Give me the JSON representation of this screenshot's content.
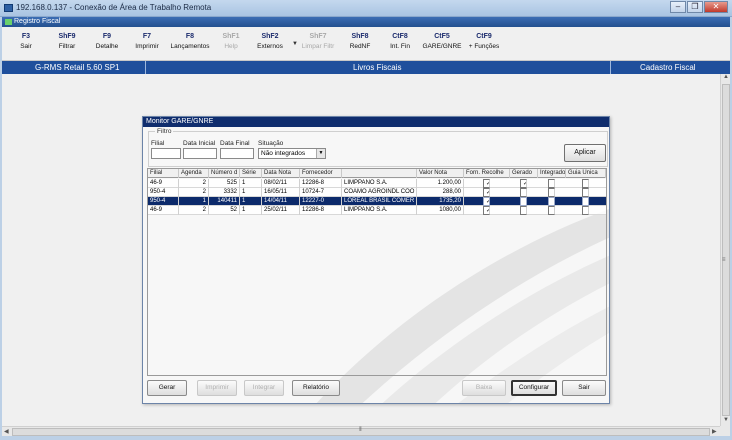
{
  "window": {
    "title": "192.168.0.137 - Conexão de Área de Trabalho Remota"
  },
  "app": {
    "title": "Registro Fiscal"
  },
  "toolbar": {
    "buttons": [
      {
        "key": "F3",
        "label": "Sair",
        "enabled": true
      },
      {
        "key": "ShF9",
        "label": "Filtrar",
        "enabled": true
      },
      {
        "key": "F9",
        "label": "Detalhe",
        "enabled": true
      },
      {
        "key": "F7",
        "label": "Imprimir",
        "enabled": true
      },
      {
        "key": "F8",
        "label": "Lançamentos",
        "enabled": true
      },
      {
        "key": "ShF1",
        "label": "Help",
        "enabled": false
      },
      {
        "key": "ShF2",
        "label": "Externos",
        "enabled": true
      },
      {
        "key": "ShF7",
        "label": "Limpar Filtr",
        "enabled": false
      },
      {
        "key": "ShF8",
        "label": "RedNF",
        "enabled": true
      },
      {
        "key": "CtF8",
        "label": "Int. Fin",
        "enabled": true
      },
      {
        "key": "CtF5",
        "label": "GARE/GNRE",
        "enabled": true
      },
      {
        "key": "CtF9",
        "label": "+ Funções",
        "enabled": true
      }
    ]
  },
  "infobar": {
    "product": "G-RMS Retail 5.60 SP1",
    "module": "Livros Fiscais",
    "screen": "Cadastro Fiscal"
  },
  "dialog": {
    "title": "Monitor GARE/GNRE",
    "filter": {
      "legend": "Filtro",
      "filial_label": "Filial",
      "data_inicial_label": "Data Inicial",
      "data_final_label": "Data Final",
      "situacao_label": "Situação",
      "filial_value": "",
      "data_inicial_value": "",
      "data_final_value": "",
      "situacao_value": "Não integrados",
      "apply_label": "Aplicar"
    },
    "table": {
      "headers": [
        "Filial",
        "Agenda",
        "Número d",
        "Série",
        "Data Nota",
        "Fornecedor",
        "",
        "Valor Nota",
        "Forn. Recolhe",
        "Gerado",
        "Integrado",
        "Guia Única"
      ],
      "rows": [
        {
          "filial": "46-9",
          "agenda": "2",
          "numero": "525",
          "serie": "1",
          "data": "08/02/11",
          "forn_cod": "12286-8",
          "forn_nome": "LIMPPANO S.A.",
          "valor": "1.200,00",
          "recolhe": true,
          "gerado": true,
          "integrado": false,
          "guia": false,
          "selected": false
        },
        {
          "filial": "950-4",
          "agenda": "2",
          "numero": "3332",
          "serie": "1",
          "data": "16/05/11",
          "forn_cod": "10724-7",
          "forn_nome": "COAMO AGROINDL COO",
          "valor": "288,00",
          "recolhe": true,
          "gerado": false,
          "integrado": false,
          "guia": false,
          "selected": false
        },
        {
          "filial": "950-4",
          "agenda": "1",
          "numero": "140411",
          "serie": "1",
          "data": "14/04/11",
          "forn_cod": "12227-0",
          "forn_nome": "LOREAL BRASIL COMER",
          "valor": "1735,20",
          "recolhe": true,
          "gerado": false,
          "integrado": false,
          "guia": false,
          "selected": true
        },
        {
          "filial": "46-9",
          "agenda": "2",
          "numero": "52",
          "serie": "1",
          "data": "25/02/11",
          "forn_cod": "12286-8",
          "forn_nome": "LIMPPANO S.A.",
          "valor": "1080,00",
          "recolhe": true,
          "gerado": false,
          "integrado": false,
          "guia": false,
          "selected": false
        }
      ]
    },
    "buttons": {
      "gerar": "Gerar",
      "imprimir": "Imprimir",
      "integrar": "Integrar",
      "relatorio": "Relatório",
      "baixa": "Baixa",
      "configurar": "Configurar",
      "sair": "Sair"
    }
  },
  "colors": {
    "infobar": "#1f4f9c",
    "selection": "#0c2a6b",
    "dialog_title": "#0f2d6e"
  }
}
